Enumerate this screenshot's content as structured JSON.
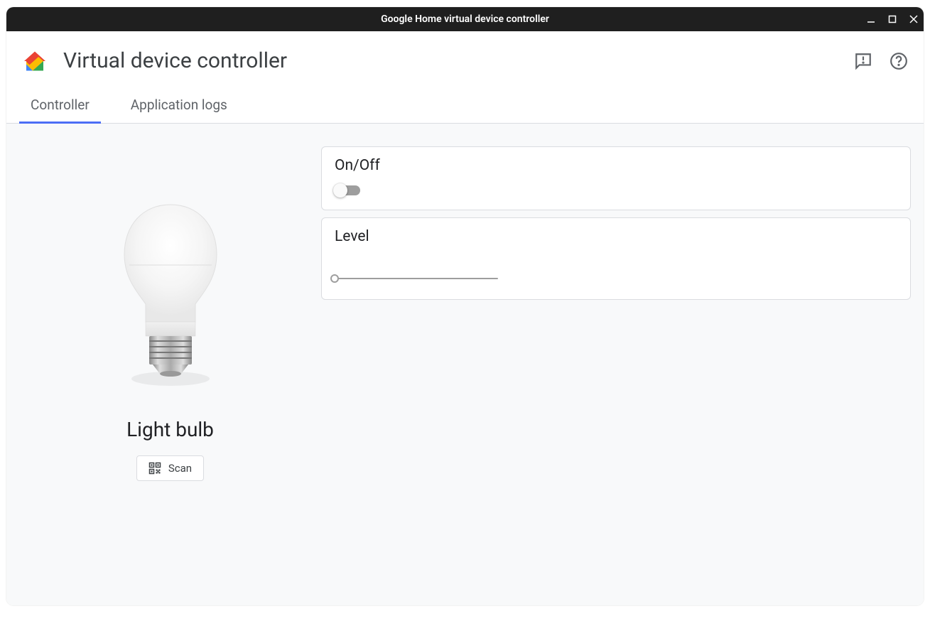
{
  "window": {
    "title": "Google Home virtual device controller"
  },
  "header": {
    "app_title": "Virtual device controller"
  },
  "tabs": [
    {
      "label": "Controller",
      "active": true
    },
    {
      "label": "Application logs",
      "active": false
    }
  ],
  "device": {
    "name": "Light bulb",
    "scan_label": "Scan"
  },
  "controls": {
    "onoff": {
      "label": "On/Off",
      "value": false
    },
    "level": {
      "label": "Level",
      "value": 0
    }
  }
}
